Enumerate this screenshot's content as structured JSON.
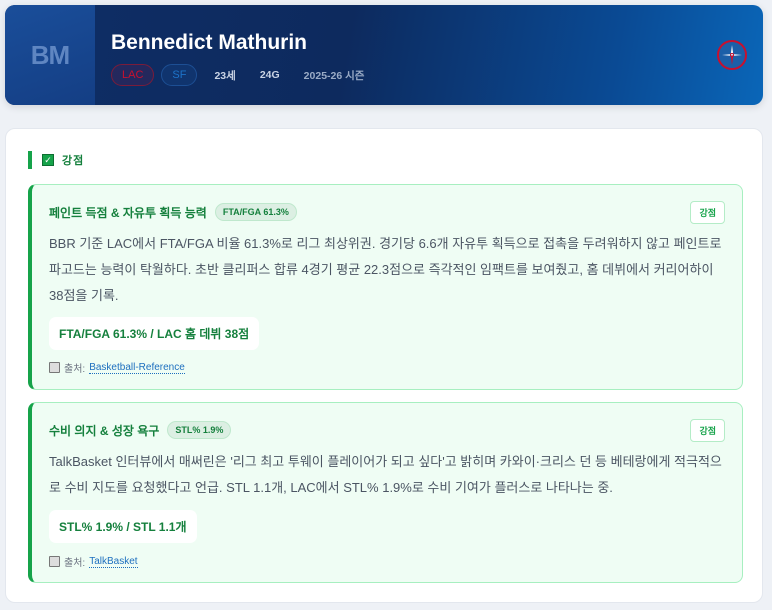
{
  "player": {
    "initials": "BM",
    "name": "Bennedict Mathurin",
    "team": "LAC",
    "position": "SF",
    "age": "23세",
    "games": "24G",
    "season": "2025-26 시즌"
  },
  "colors": {
    "team": "#c8102e",
    "accent": "#16a34a"
  },
  "section": {
    "icon": "check-box-icon",
    "title": "강점"
  },
  "cards": [
    {
      "title": "페인트 득점 & 자유투 획득 능력",
      "badge": "FTA/FGA 61.3%",
      "tag": "강점",
      "description": "BBR 기준 LAC에서 FTA/FGA 비율 61.3%로 리그 최상위권. 경기당 6.6개 자유투 획득으로 접촉을 두려워하지 않고 페인트로 파고드는 능력이 탁월하다. 초반 클리퍼스 합류 4경기 평균 22.3점으로 즉각적인 임팩트를 보여줬고, 홈 데뷔에서 커리어하이 38점을 기록.",
      "stat": "FTA/FGA 61.3% / LAC 홈 데뷔 38점",
      "source_label": "출처:",
      "source": "Basketball-Reference"
    },
    {
      "title": "수비 의지 & 성장 욕구",
      "badge": "STL% 1.9%",
      "tag": "강점",
      "description": "TalkBasket 인터뷰에서 매써린은 '리그 최고 투웨이 플레이어가 되고 싶다'고 밝히며 카와이·크리스 던 등 베테랑에게 적극적으로 수비 지도를 요청했다고 언급. STL 1.1개, LAC에서 STL% 1.9%로 수비 기여가 플러스로 나타나는 중.",
      "stat": "STL% 1.9% / STL 1.1개",
      "source_label": "출처:",
      "source": "TalkBasket"
    }
  ]
}
